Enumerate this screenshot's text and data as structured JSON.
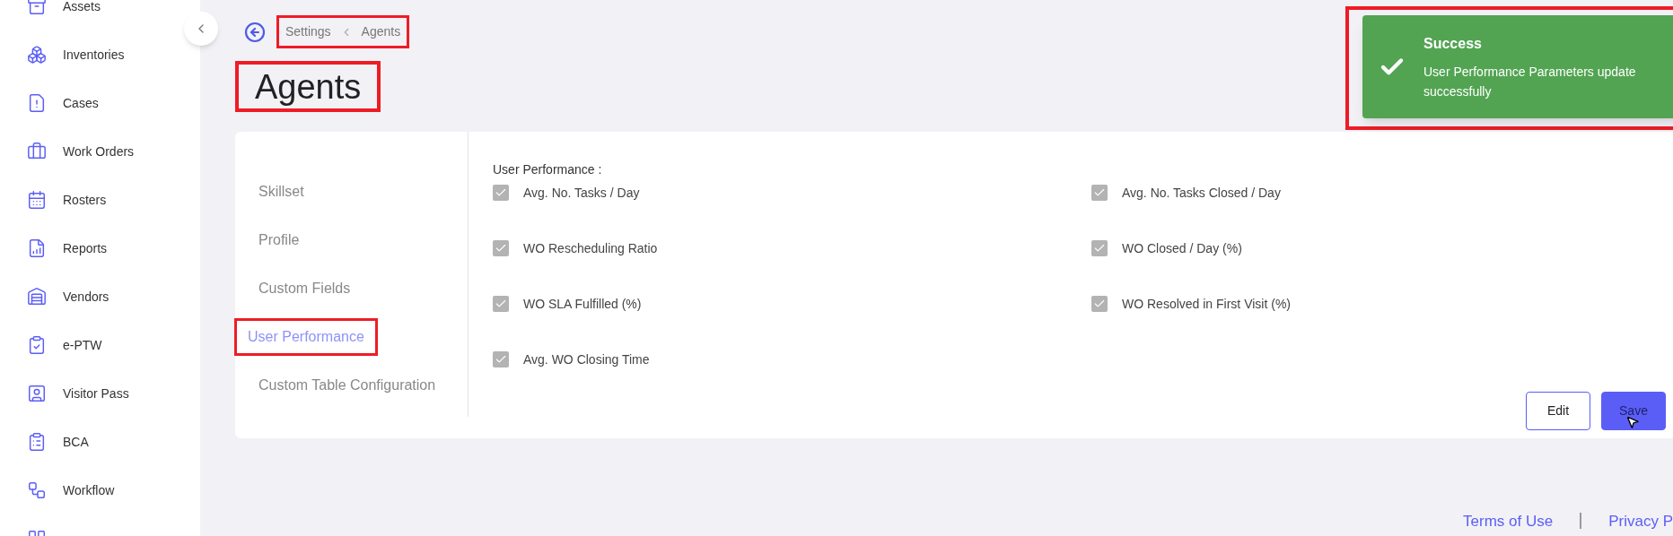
{
  "sidebar": {
    "items": [
      {
        "label": "Assets"
      },
      {
        "label": "Inventories"
      },
      {
        "label": "Cases"
      },
      {
        "label": "Work Orders"
      },
      {
        "label": "Rosters"
      },
      {
        "label": "Reports"
      },
      {
        "label": "Vendors"
      },
      {
        "label": "e-PTW"
      },
      {
        "label": "Visitor Pass"
      },
      {
        "label": "BCA"
      },
      {
        "label": "Workflow"
      }
    ],
    "more_below": true
  },
  "breadcrumb": [
    "Settings",
    "Agents"
  ],
  "page_title": "Agents",
  "settings_tabs": [
    {
      "label": "Skillset",
      "selected": false
    },
    {
      "label": "Profile",
      "selected": false
    },
    {
      "label": "Custom Fields",
      "selected": false
    },
    {
      "label": "User Performance",
      "selected": true
    },
    {
      "label": "Custom Table Configuration",
      "selected": false
    }
  ],
  "section_title": "User Performance :",
  "parameters": [
    {
      "label": "Avg. No. Tasks / Day",
      "checked": true,
      "disabled": true
    },
    {
      "label": "Avg. No. Tasks Closed / Day",
      "checked": true,
      "disabled": true
    },
    {
      "label": "WO Rescheduling Ratio",
      "checked": true,
      "disabled": true
    },
    {
      "label": "WO Closed / Day (%)",
      "checked": true,
      "disabled": true
    },
    {
      "label": "WO SLA Fulfilled (%)",
      "checked": true,
      "disabled": true
    },
    {
      "label": "WO Resolved in First Visit (%)",
      "checked": true,
      "disabled": true
    },
    {
      "label": "Avg. WO Closing Time",
      "checked": true,
      "disabled": true
    }
  ],
  "buttons": [
    {
      "label": "Edit",
      "kind": "outline",
      "disabled": false
    },
    {
      "label": "Save",
      "kind": "primary",
      "disabled": true
    }
  ],
  "toast": {
    "title": "Success",
    "message_lines": [
      "User Performance Parameters update",
      "successfully"
    ]
  },
  "footer": [
    "Terms of Use",
    "Privacy P"
  ]
}
